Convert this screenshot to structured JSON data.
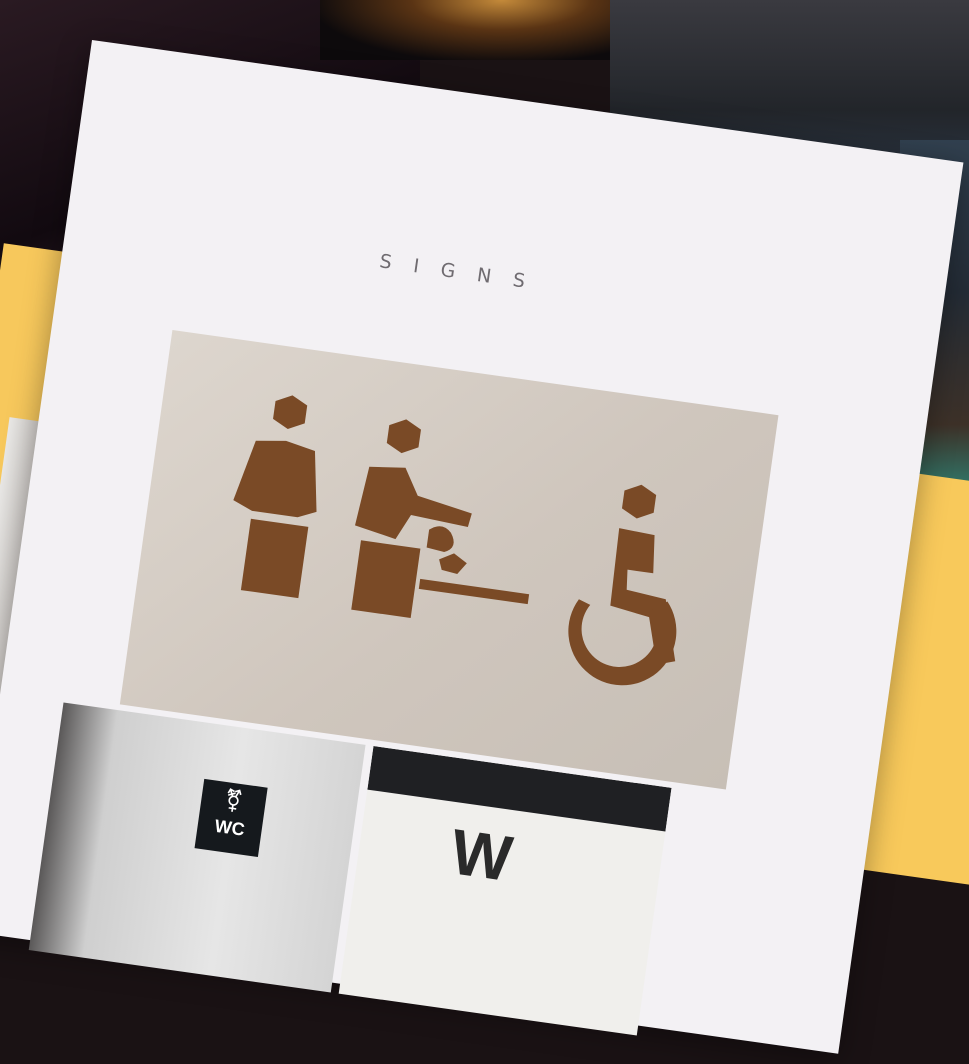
{
  "card": {
    "title": "SIGNS",
    "photos": [
      {
        "subject": "baby-changing-and-accessible-restroom-sign"
      },
      {
        "subject": "all-gender-wc-sign",
        "symbol": "⚧",
        "text": "WC"
      },
      {
        "subject": "w-sign",
        "text": "W"
      }
    ]
  },
  "colors": {
    "card_background": "#f3f1f4",
    "accent_yellow": "#f8c95b",
    "sign_brown": "#7a4a26"
  }
}
